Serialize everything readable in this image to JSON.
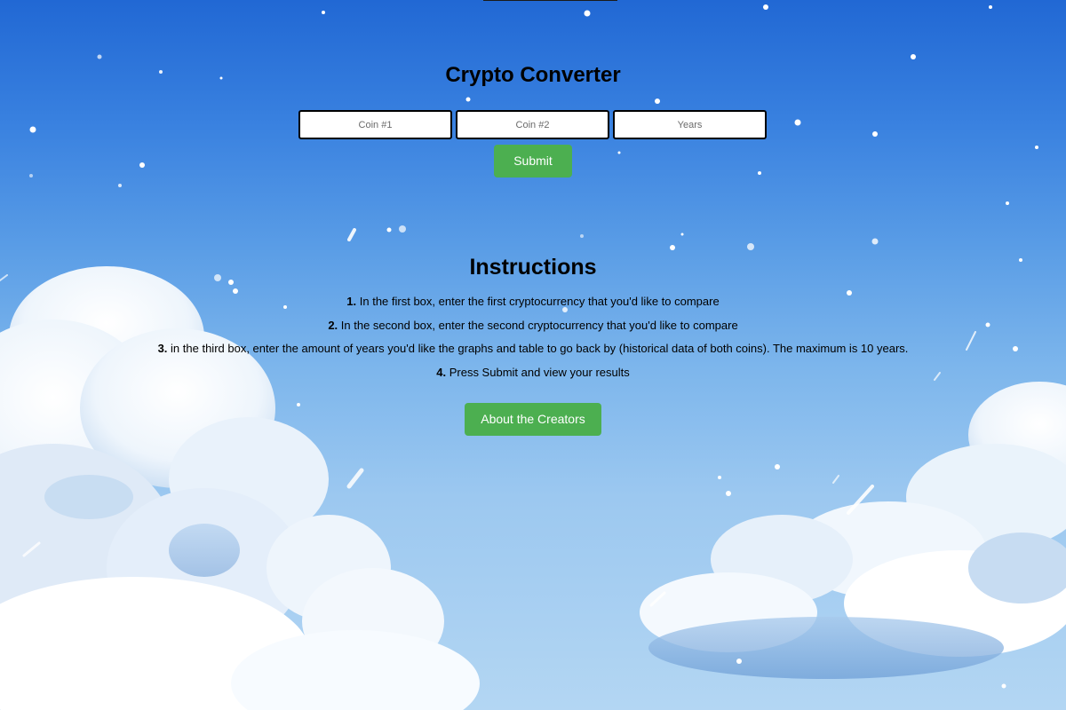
{
  "header": {
    "title": "Crypto Converter"
  },
  "form": {
    "coin1_placeholder": "Coin #1",
    "coin2_placeholder": "Coin #2",
    "years_placeholder": "Years",
    "submit_label": "Submit"
  },
  "instructions": {
    "title": "Instructions",
    "steps": [
      {
        "num": "1.",
        "text": "In the first box, enter the first cryptocurrency that you'd like to compare"
      },
      {
        "num": "2.",
        "text": "In the second box, enter the second cryptocurrency that you'd like to compare"
      },
      {
        "num": "3.",
        "text": "in the third box, enter the amount of years you'd like the graphs and table to go back by (historical data of both coins). The maximum is 10 years."
      },
      {
        "num": "4.",
        "text": "Press Submit and view your results"
      }
    ]
  },
  "about": {
    "label": "About the Creators"
  },
  "colors": {
    "accent_button": "#4caf50",
    "sky_top": "#2168d4",
    "sky_bottom": "#b3d6f3"
  },
  "background": {
    "icon": "sky-clouds-background"
  }
}
